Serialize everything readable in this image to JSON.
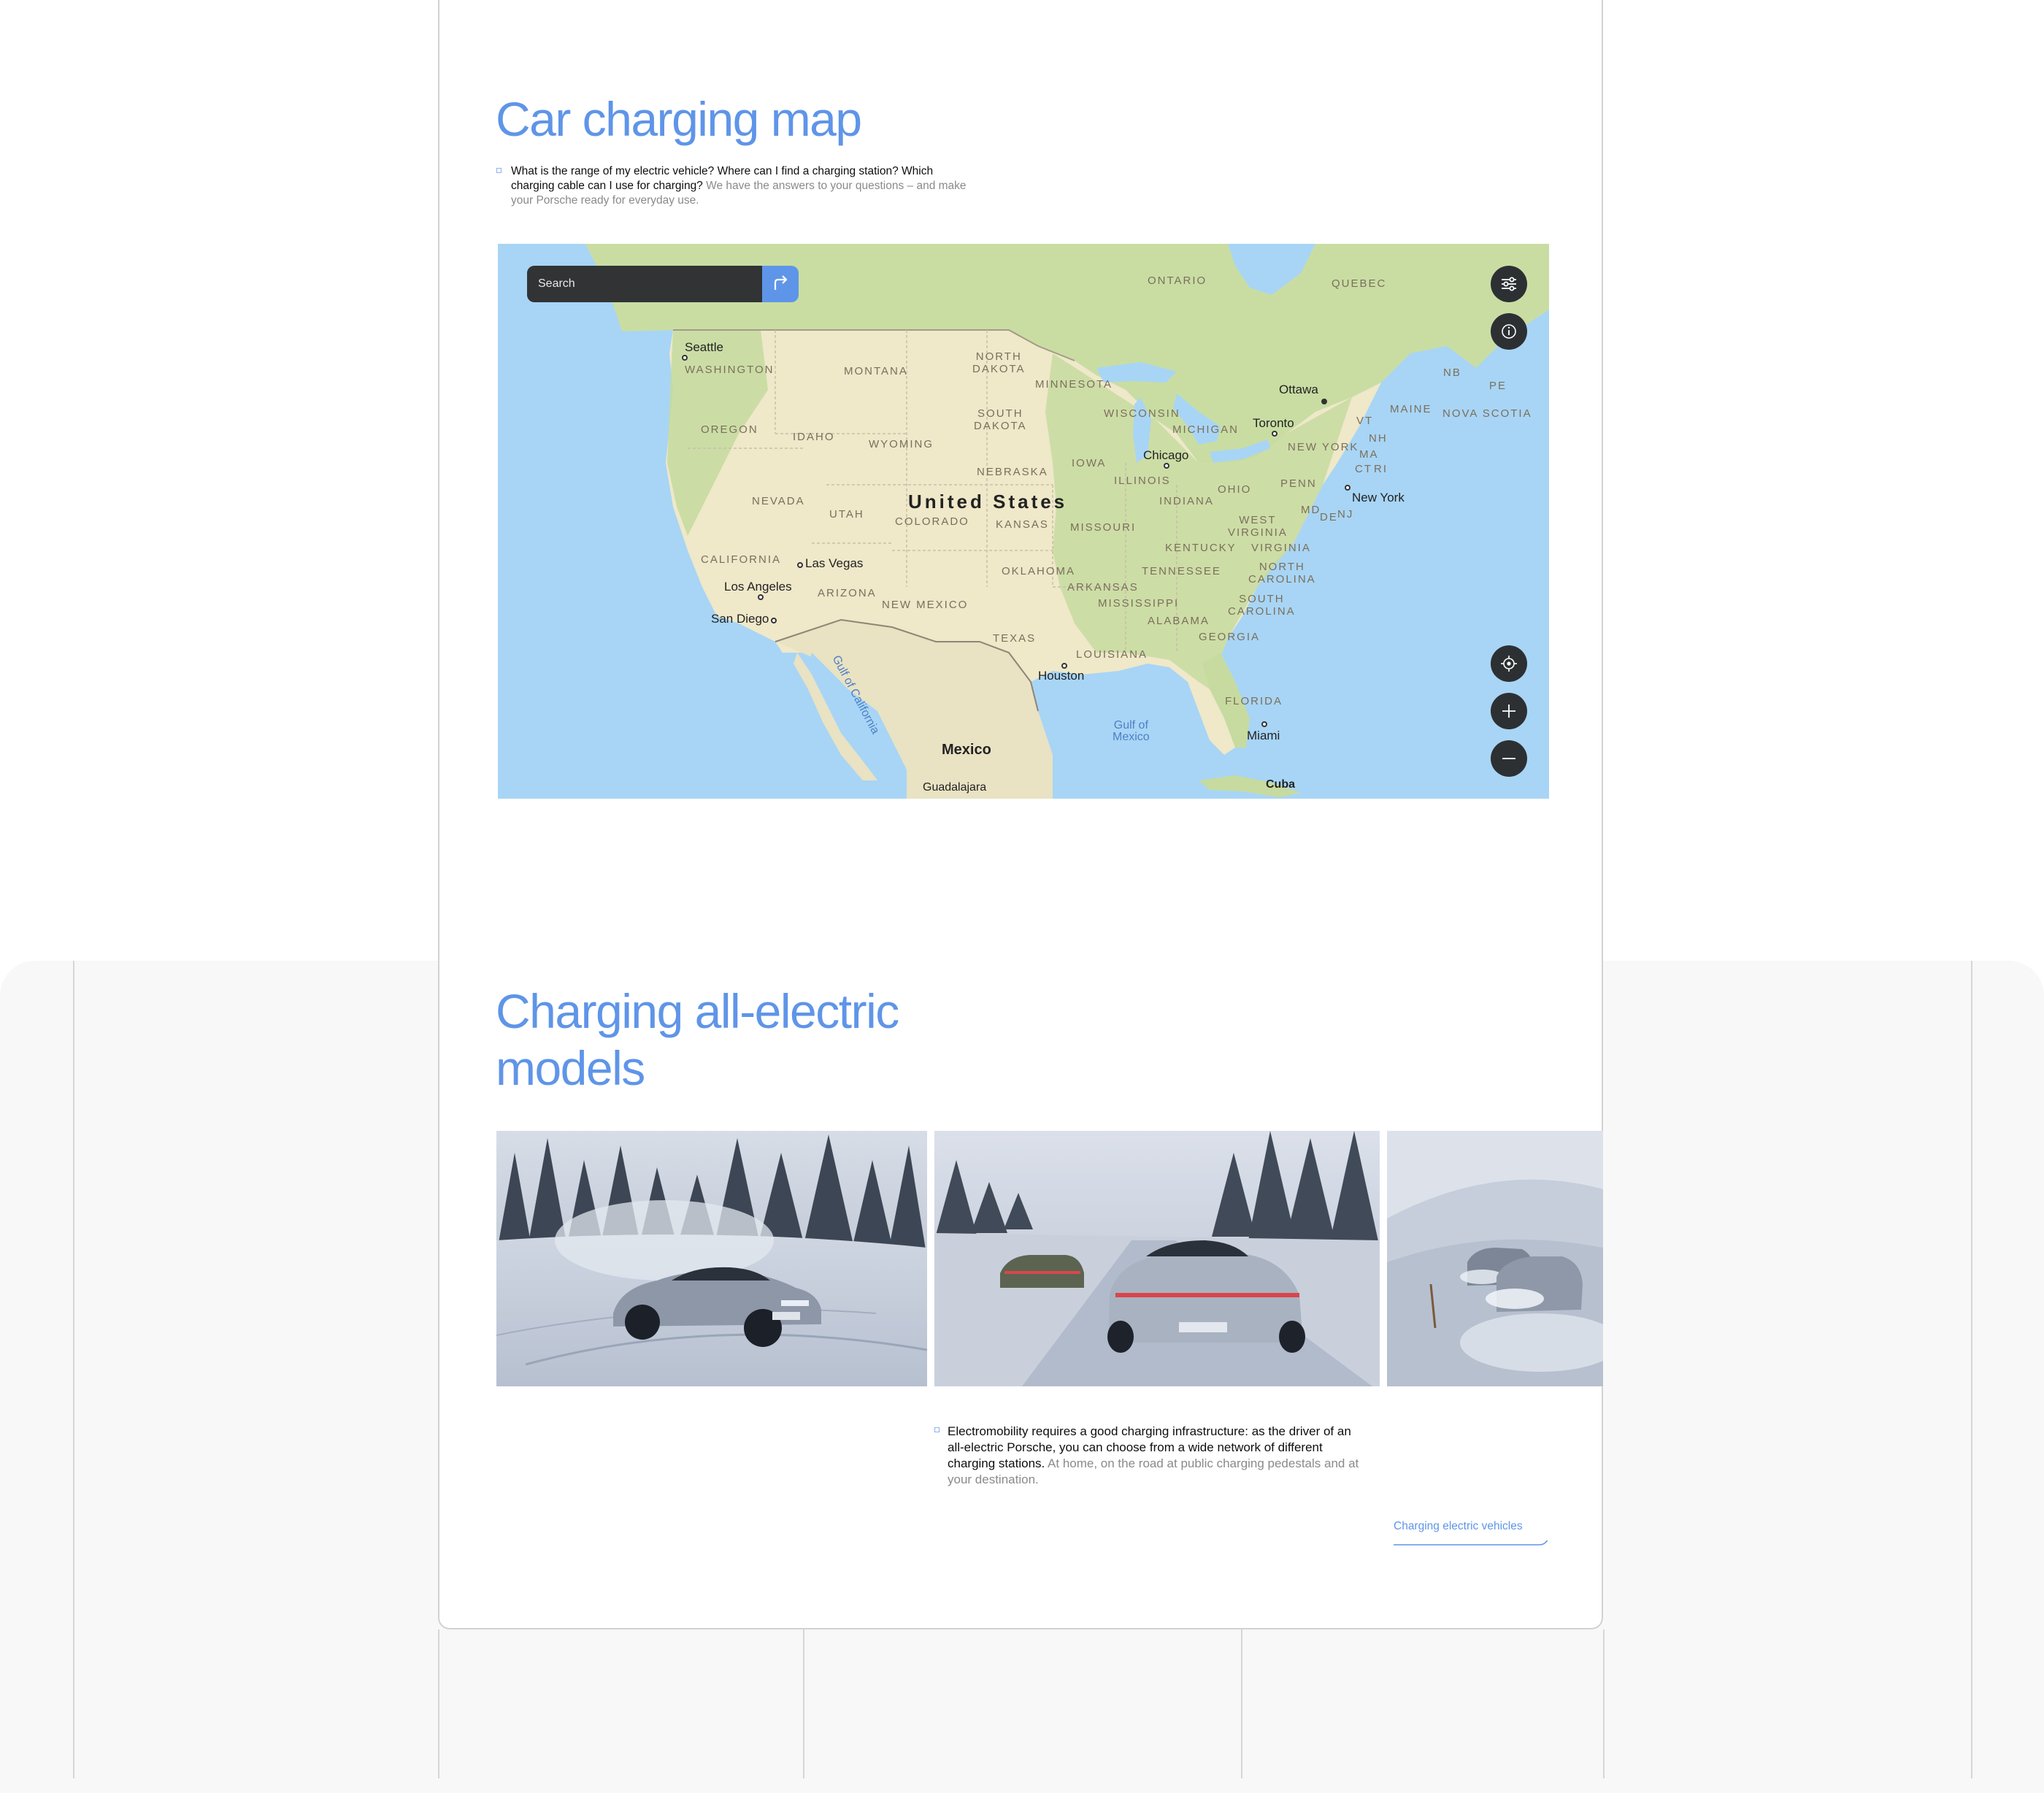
{
  "section_map": {
    "heading": "Car charging map",
    "intro_bold": "What is the range of my electric vehicle? Where can I find a charging station? Which charging cable can I use for charging?",
    "intro_light": "We have the answers to your questions – and make your Porsche ready for everyday use.",
    "search": {
      "placeholder": "Search"
    },
    "icons": {
      "search": "search-icon",
      "route": "route-arrow-icon",
      "filter": "sliders-icon",
      "info": "info-icon",
      "locate": "locate-icon",
      "zoom_in": "plus-icon",
      "zoom_out": "minus-icon"
    },
    "map_labels": {
      "countries": [
        "United States",
        "Mexico",
        "Cuba"
      ],
      "provinces": [
        "ONTARIO",
        "QUEBEC",
        "NB",
        "PE",
        "NOVA SCOTIA"
      ],
      "states": [
        "WASHINGTON",
        "MONTANA",
        "NORTH DAKOTA",
        "MINNESOTA",
        "OREGON",
        "IDAHO",
        "SOUTH DAKOTA",
        "WYOMING",
        "WISCONSIN",
        "MICHIGAN",
        "IOWA",
        "NEBRASKA",
        "NEVADA",
        "UTAH",
        "COLORADO",
        "KANSAS",
        "MISSOURI",
        "ILLINOIS",
        "INDIANA",
        "OHIO",
        "PENN",
        "NEW YORK",
        "VT",
        "NH",
        "MAINE",
        "MA",
        "CT",
        "RI",
        "MD",
        "DE",
        "NJ",
        "WEST VIRGINIA",
        "VIRGINIA",
        "KENTUCKY",
        "CALIFORNIA",
        "ARIZONA",
        "NEW MEXICO",
        "OKLAHOMA",
        "ARKANSAS",
        "TENNESSEE",
        "NORTH CAROLINA",
        "SOUTH CAROLINA",
        "MISSISSIPPI",
        "ALABAMA",
        "GEORGIA",
        "TEXAS",
        "LOUISIANA",
        "FLORIDA"
      ],
      "cities": [
        "Seattle",
        "Ottawa",
        "Toronto",
        "Chicago",
        "New York",
        "Las Vegas",
        "Los Angeles",
        "San Diego",
        "Houston",
        "Miami",
        "Guadalajara"
      ],
      "water": [
        "Gulf of California",
        "Gulf of Mexico"
      ]
    }
  },
  "section_models": {
    "heading_line1": "Charging all-electric",
    "heading_line2": "models",
    "body_bold": "Electromobility requires a good charging infrastructure: as the driver of an all-electric Porsche, you can choose from a wide network of different charging stations.",
    "body_light": "At home, on the road at public charging pedestals and at your destination.",
    "link_label": "Charging electric vehicles",
    "photos": [
      "porsche-taycan-drifting-snow-photo",
      "two-porsche-taycan-snow-road-photo",
      "porsche-taycans-snow-bend-photo"
    ]
  }
}
